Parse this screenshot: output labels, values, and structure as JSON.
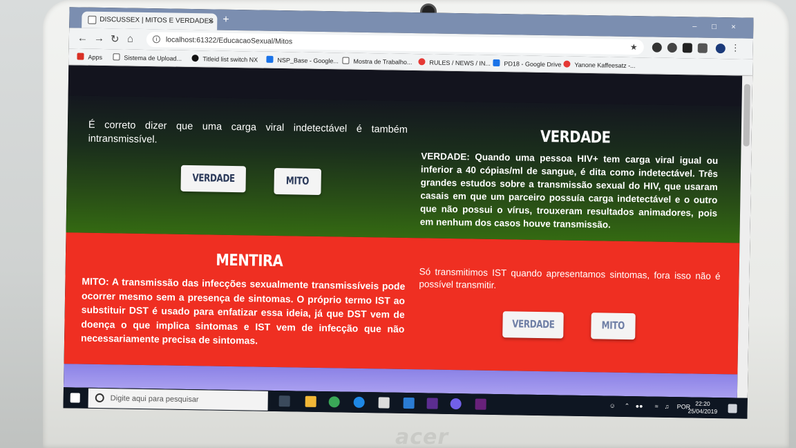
{
  "browser": {
    "tab_title": "DISCUSSEX | MITOS E VERDADES",
    "tab_close": "×",
    "new_tab": "+",
    "url": "localhost:61322/EducacaoSexual/Mitos",
    "window_controls": [
      "–",
      "□",
      "×"
    ],
    "bookmarks": [
      {
        "label": "Apps",
        "icon": "apps-icon",
        "color": "#d93025"
      },
      {
        "label": "Sistema de Upload...",
        "icon": "page-icon",
        "color": "#ffffff"
      },
      {
        "label": "Titleid list switch NX",
        "icon": "github-icon",
        "color": "#111111"
      },
      {
        "label": "NSP_Base - Google...",
        "icon": "drive-icon",
        "color": "#1a73e8"
      },
      {
        "label": "Mostra de Trabalho...",
        "icon": "page-icon",
        "color": "#ffffff"
      },
      {
        "label": "RULES / NEWS / IN...",
        "icon": "site-icon",
        "color": "#e53935"
      },
      {
        "label": "PD18 - Google Drive",
        "icon": "drive-icon",
        "color": "#1a73e8"
      },
      {
        "label": "Yanone Kaffeesatz -...",
        "icon": "font-icon",
        "color": "#e53935"
      }
    ]
  },
  "page": {
    "verdade_block": {
      "question": "É correto dizer que uma carga viral indetectável é também intransmissível.",
      "btn_verdade": "VERDADE",
      "btn_mito": "MITO",
      "answer_title": "VERDADE",
      "answer_text": "VERDADE: Quando uma pessoa HIV+ tem carga viral igual ou inferior a 40 cópias/ml de sangue, é dita como indetectável. Três grandes estudos sobre a transmissão sexual do HIV, que usaram casais em que um parceiro possuía carga indetectável e o outro que não possui o vírus, trouxeram resultados animadores, pois em nenhum dos casos houve transmissão."
    },
    "mito_block": {
      "answer_title": "MENTIRA",
      "answer_text": "MITO: A transmissão das infecções sexualmente transmissíveis pode ocorrer mesmo sem a presença de sintomas. O próprio termo IST ao substituir DST é usado para enfatizar essa ideia, já que DST vem de doença o que implica sintomas e IST vem de infecção que não necessariamente precisa de sintomas.",
      "question": "Só transmitimos IST quando apresentamos sintomas, fora isso não é possível transmitir.",
      "btn_verdade": "VERDADE",
      "btn_mito": "MITO"
    },
    "colors": {
      "green_section": "#2a5116",
      "red_section": "#ef2f22",
      "purple_section": "#8b82e6"
    }
  },
  "taskbar": {
    "search_placeholder": "Digite aqui para pesquisar",
    "language": "POR",
    "time": "22:20",
    "date": "25/04/2019"
  },
  "device": {
    "brand": "acer"
  }
}
